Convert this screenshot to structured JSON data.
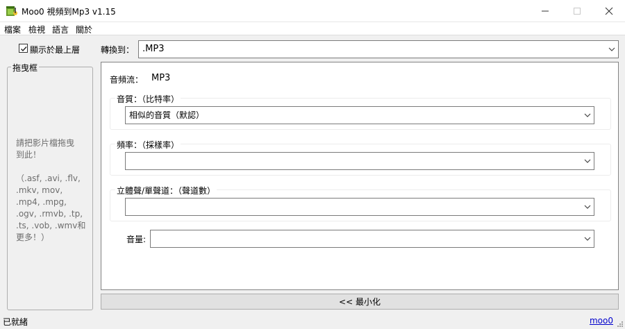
{
  "window": {
    "title": "Moo0 視頻到Mp3 v1.15",
    "icon": "app-icon",
    "controls": {
      "minimize_icon": "minimize-icon",
      "maximize_icon": "maximize-icon",
      "close_icon": "close-icon"
    }
  },
  "menubar": {
    "items": [
      {
        "label": "檔案"
      },
      {
        "label": "檢視"
      },
      {
        "label": "語言"
      },
      {
        "label": "關於"
      }
    ]
  },
  "options": {
    "stay_on_top_label": "顯示於最上層",
    "stay_on_top_checked": true
  },
  "drag_box": {
    "title": "拖曳框",
    "hint": "請把影片檔拖曳\n到此！\n\n（.asf, .avi, .flv,\n.mkv, mov,\n.mp4, .mpg,\n.ogv, .rmvb, .tp,\n.ts, .vob, .wmv和\n更多！）"
  },
  "convert": {
    "label": "轉換到：",
    "value": ".MP3"
  },
  "audio": {
    "stream_label": "音頻流：",
    "stream_value": "MP3",
    "quality": {
      "title": "音質：（比特率）",
      "value": "相似的音質（默認）"
    },
    "frequency": {
      "title": "頻率：（採樣率）",
      "value": ""
    },
    "channels": {
      "title": "立體聲/單聲道：（聲道數）",
      "value": ""
    },
    "volume": {
      "label": "音量:",
      "value": ""
    }
  },
  "minimize_button": {
    "label": "<< 最小化"
  },
  "statusbar": {
    "status": "已就緒",
    "link": "moo0"
  },
  "colors": {
    "title_bg": "#ffffff",
    "window_bg": "#f0f0f0",
    "panel_bg": "#ffffff",
    "button_bg": "#e1e1e1",
    "link": "#0000cc",
    "hint_text": "#6d6d6d"
  }
}
